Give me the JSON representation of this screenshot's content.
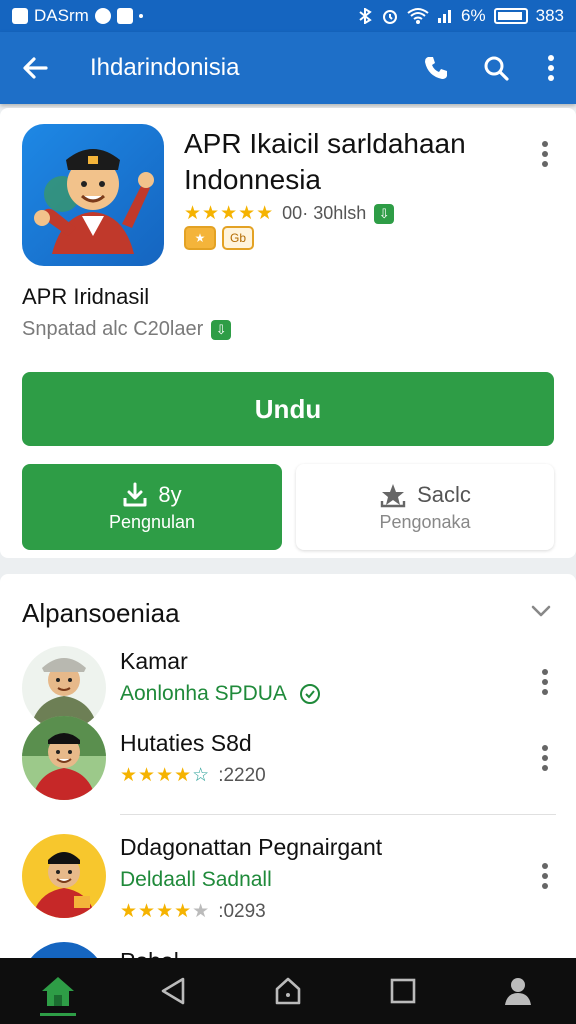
{
  "status_bar": {
    "carrier": "DASrm",
    "battery_text": "6%",
    "time": "383"
  },
  "app_bar": {
    "title": "Ihdarindonisia",
    "icons": [
      "back-arrow-icon",
      "phone-icon",
      "search-icon",
      "more-vert-icon"
    ]
  },
  "app_detail": {
    "title": "APR Ikaicil sarldahaan Indonnesia",
    "rating_stars": 5,
    "rating_text": "00· 30hlsh",
    "badges": [
      "★",
      "Gb"
    ],
    "developer": "APR Iridnasil",
    "developer_sub": "Snpatad alc C20laer",
    "install_label": "Undu",
    "download_button": {
      "top": "8y",
      "bottom": "Pengnulan"
    },
    "save_button": {
      "top": "Saclc",
      "bottom": "Pengonaka"
    }
  },
  "section": {
    "title": "Alpansoeniaa",
    "items": [
      {
        "name": "Kamar",
        "subtitle": "Aonlonha SPDUA"
      },
      {
        "name": "Hutaties S8d",
        "rating_stars": 4,
        "rating_text": ":2220"
      },
      {
        "name": "Ddagonattan Pegnairgant",
        "subtitle": "Deldaall Sadnall",
        "rating_stars": 4.5,
        "rating_text": ":0293"
      },
      {
        "name": "Pobal"
      }
    ]
  },
  "colors": {
    "primary_blue": "#1e6fc8",
    "status_blue": "#1565c0",
    "green": "#2e9d46",
    "star": "#f5b301"
  },
  "nav_bar": {
    "items": [
      "home-icon",
      "back-triangle-icon",
      "house-outline-icon",
      "recents-square-icon",
      "profile-icon"
    ],
    "active": "home-icon"
  }
}
